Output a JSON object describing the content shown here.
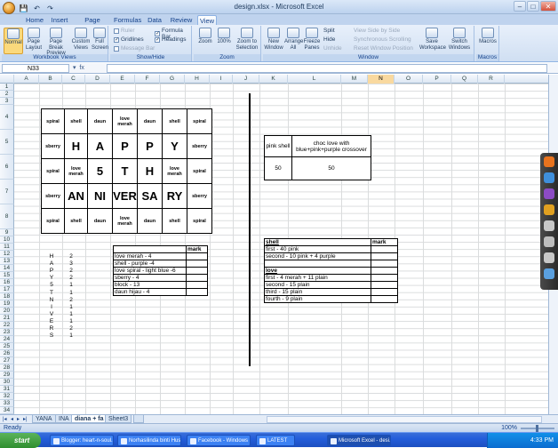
{
  "window": {
    "title": "design.xlsx - Microsoft Excel",
    "min": "–",
    "max": "□",
    "close": "✕"
  },
  "qat": {
    "save": "💾",
    "undo": "↶",
    "redo": "↷"
  },
  "tabs": [
    "Home",
    "Insert",
    "Page Layout",
    "Formulas",
    "Data",
    "Review",
    "View"
  ],
  "ribbon": {
    "views": {
      "normal": "Normal",
      "page_layout": "Page Layout",
      "page_break": "Page Break Preview",
      "custom": "Custom Views",
      "full": "Full Screen",
      "label": "Workbook Views"
    },
    "showhide": {
      "ruler": "Ruler",
      "gridlines": "Gridlines",
      "message_bar": "Message Bar",
      "formula_bar": "Formula Bar",
      "headings": "Headings",
      "label": "Show/Hide"
    },
    "zoom": {
      "zoom": "Zoom",
      "hundred": "100%",
      "selection": "Zoom to Selection",
      "label": "Zoom"
    },
    "window": {
      "new": "New Window",
      "arrange": "Arrange All",
      "freeze": "Freeze Panes",
      "split": "Split",
      "hide": "Hide",
      "unhide": "Unhide",
      "side": "View Side by Side",
      "sync": "Synchronous Scrolling",
      "reset": "Reset Window Position",
      "save": "Save Workspace",
      "switch": "Switch Windows",
      "label": "Window"
    },
    "macros": {
      "macros": "Macros",
      "label": "Macros"
    }
  },
  "formula": {
    "namebox": "N33",
    "fx": "fx",
    "value": ""
  },
  "columns": [
    "A",
    "B",
    "C",
    "D",
    "E",
    "F",
    "G",
    "H",
    "I",
    "J",
    "K",
    "L",
    "M",
    "N",
    "O",
    "P",
    "Q",
    "R"
  ],
  "rows": [
    "1",
    "2",
    "3",
    "4",
    "5",
    "6",
    "7",
    "8",
    "9",
    "10",
    "11",
    "12",
    "13",
    "14",
    "15",
    "16",
    "17",
    "18",
    "19",
    "20",
    "21",
    "22",
    "23",
    "24",
    "25",
    "26",
    "27",
    "28",
    "29",
    "30",
    "31",
    "32",
    "33",
    "34",
    "35",
    "36"
  ],
  "design": [
    [
      "spiral",
      "shell",
      "daun",
      "love merah",
      "daun",
      "shell",
      "spiral"
    ],
    [
      "sberry",
      "H",
      "A",
      "P",
      "P",
      "Y",
      "sberry"
    ],
    [
      "spiral",
      "love merah",
      "5",
      "T",
      "H",
      "love merah",
      "spiral"
    ],
    [
      "sberry",
      "AN",
      "NI",
      "VER",
      "SA",
      "RY",
      "sberry"
    ],
    [
      "spiral",
      "shell",
      "daun",
      "love merah",
      "daun",
      "shell",
      "spiral"
    ]
  ],
  "letters": [
    [
      "H",
      "2"
    ],
    [
      "A",
      "3"
    ],
    [
      "P",
      "2"
    ],
    [
      "Y",
      "2"
    ],
    [
      "5",
      "1"
    ],
    [
      "T",
      "1"
    ],
    [
      "N",
      "2"
    ],
    [
      "I",
      "1"
    ],
    [
      "V",
      "1"
    ],
    [
      "E",
      "1"
    ],
    [
      "R",
      "2"
    ],
    [
      "S",
      "1"
    ]
  ],
  "mark_table": {
    "header": "mark",
    "items": [
      "love merah - 4",
      "shell - purple -4",
      "love spiral - light blue -6",
      "sberry - 4",
      "block - 13",
      "daun hijau - 4"
    ]
  },
  "pink_table": {
    "h1": "pink shell",
    "h2": "choc love with blue+pink+purple crossover",
    "v1": "50",
    "v2": "50"
  },
  "right_list": {
    "header": "mark",
    "shell_title": "shell",
    "shell": [
      "first - 40 pink",
      "second - 10 pink + 4 purple"
    ],
    "love_title": "love",
    "love": [
      "first - 4 merah + 11 plain",
      "second - 15 plain",
      "third - 15 plain",
      "fourth - 9 plain"
    ]
  },
  "sheets": [
    "YANA",
    "INA",
    "diana + fa",
    "Sheet3"
  ],
  "sheet_nav": [
    "|◂",
    "◂",
    "▸",
    "▸|"
  ],
  "status": {
    "ready": "Ready",
    "zoom": "100%"
  },
  "taskbar": {
    "start": "start",
    "items": [
      "Blogger: heart-n-soul...",
      "Norhasilinda binti Hus...",
      "Facebook - Windows ...",
      "LATEST",
      "Microsoft Excel - desi..."
    ],
    "clock": "4:33 PM"
  }
}
